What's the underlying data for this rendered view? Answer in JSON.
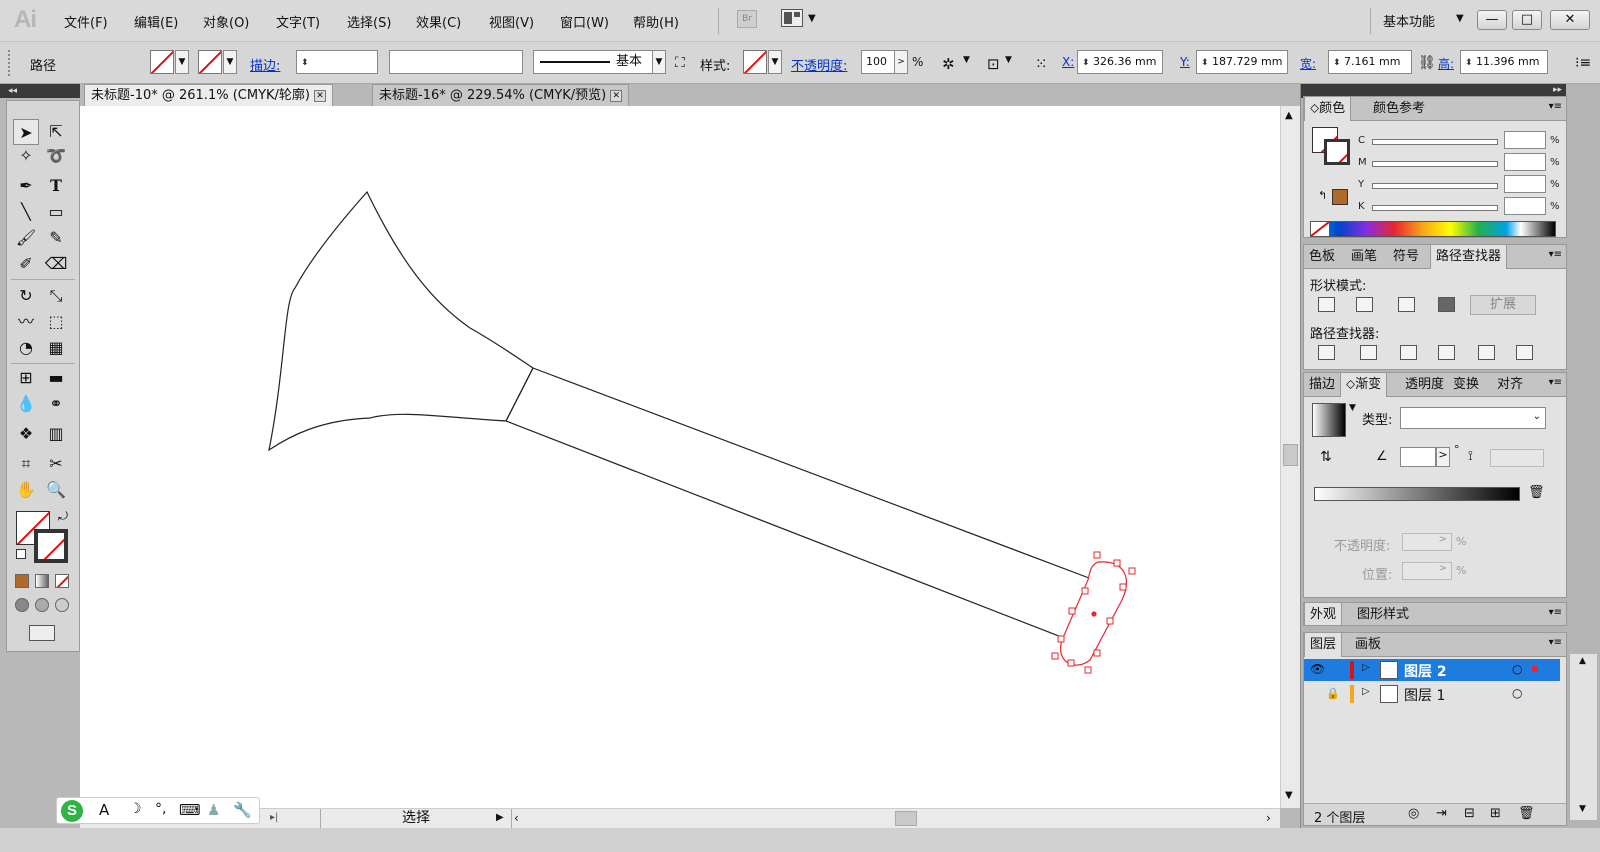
{
  "app_logo": "Ai",
  "menu": [
    "文件(F)",
    "编辑(E)",
    "对象(O)",
    "文字(T)",
    "选择(S)",
    "效果(C)",
    "视图(V)",
    "窗口(W)",
    "帮助(H)"
  ],
  "workspace": "基本功能",
  "window_buttons": [
    "—",
    "□",
    "✕"
  ],
  "control": {
    "object_type": "路径",
    "stroke_label": "描边:",
    "stroke_weight": "",
    "brush_value": "",
    "profile_label": "基本",
    "style_label": "样式:",
    "opacity_label": "不透明度:",
    "opacity_value": "100",
    "percent": "%",
    "x_label": "X:",
    "x_value": "326.36 mm",
    "y_label": "Y:",
    "y_value": "187.729 mm",
    "w_label": "宽:",
    "w_value": "7.161 mm",
    "h_label": "高:",
    "h_value": "11.396 mm"
  },
  "tabs": [
    {
      "label": "未标题-10* @ 261.1% (CMYK/轮廓)"
    },
    {
      "label": "未标题-16* @ 229.54% (CMYK/预览)"
    }
  ],
  "status": {
    "tool": "选择"
  },
  "color_panel": {
    "tabs": [
      "颜色",
      "颜色参考"
    ],
    "channels": [
      "C",
      "M",
      "Y",
      "K"
    ],
    "values": [
      "",
      "",
      "",
      ""
    ],
    "percent": "%",
    "swatch_color": "#b06a2a"
  },
  "pathfinder_panel": {
    "tabs": [
      "色板",
      "画笔",
      "符号",
      "路径查找器"
    ],
    "shape_modes_label": "形状模式:",
    "expand_label": "扩展",
    "pathfinders_label": "路径查找器:"
  },
  "gradient_panel": {
    "tabs": [
      "描边",
      "渐变",
      "透明度",
      "变换",
      "对齐"
    ],
    "type_label": "类型:",
    "type_value": "",
    "angle_value": "",
    "degree": "°",
    "opacity_label": "不透明度:",
    "position_label": "位置:",
    "percent": "%"
  },
  "appearance_panel": {
    "tabs": [
      "外观",
      "图形样式"
    ]
  },
  "layers_panel": {
    "tabs": [
      "图层",
      "画板"
    ],
    "layers": [
      {
        "name": "图层 2",
        "selected": true,
        "color": "#d11"
      },
      {
        "name": "图层 1",
        "selected": false,
        "color": "#f7a61a"
      }
    ],
    "count": "2 个图层"
  },
  "colors": {
    "selection": "#e8262c",
    "layer_highlight": "#1e7be0",
    "accent_link": "#0033cc"
  }
}
